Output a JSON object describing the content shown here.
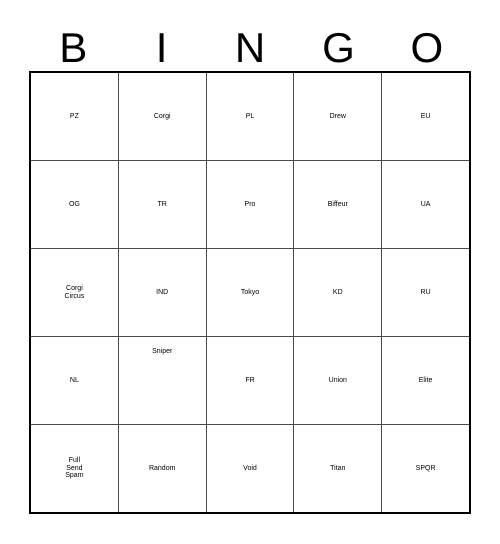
{
  "card": {
    "title_letters": [
      "B",
      "I",
      "N",
      "G",
      "O"
    ],
    "colors": {
      "background": "#ffffff",
      "text": "#000000",
      "grid_line": "#4a4a4a",
      "outer_border": "#000000"
    },
    "rows": [
      [
        {
          "text": "PZ",
          "size": "size-xl",
          "valign": "middle"
        },
        {
          "text": "Corgi",
          "size": "size-md",
          "valign": "middle"
        },
        {
          "text": "PL",
          "size": "size-xl",
          "valign": "middle"
        },
        {
          "text": "Drew",
          "size": "size-md",
          "valign": "middle"
        },
        {
          "text": "EU",
          "size": "size-xl",
          "valign": "middle"
        }
      ],
      [
        {
          "text": "OG",
          "size": "size-xl",
          "valign": "middle"
        },
        {
          "text": "TR",
          "size": "size-xl",
          "valign": "middle"
        },
        {
          "text": "Pro",
          "size": "size-xl",
          "valign": "middle"
        },
        {
          "text": "Biffeur",
          "size": "size-sm",
          "valign": "middle"
        },
        {
          "text": "UA",
          "size": "size-xl",
          "valign": "middle"
        }
      ],
      [
        {
          "text": "Corgi\nCircus",
          "size": "multi2",
          "valign": "middle"
        },
        {
          "text": "IND",
          "size": "size-xl",
          "valign": "middle"
        },
        {
          "text": "Tokyo",
          "size": "size-md",
          "valign": "middle"
        },
        {
          "text": "KD",
          "size": "size-xl",
          "valign": "middle"
        },
        {
          "text": "RU",
          "size": "size-xl",
          "valign": "middle"
        }
      ],
      [
        {
          "text": "NL",
          "size": "size-xl",
          "valign": "middle"
        },
        {
          "text": "Sniper",
          "size": "size-sm",
          "valign": "top"
        },
        {
          "text": "FR",
          "size": "size-xl",
          "valign": "middle"
        },
        {
          "text": "Union",
          "size": "size-md",
          "valign": "middle"
        },
        {
          "text": "Elite",
          "size": "size-lg",
          "valign": "middle"
        }
      ],
      [
        {
          "text": "Full\nSend\nSpam",
          "size": "multi3",
          "valign": "middle"
        },
        {
          "text": "Random",
          "size": "size-xs",
          "valign": "middle"
        },
        {
          "text": "Void",
          "size": "size-lg",
          "valign": "middle"
        },
        {
          "text": "Titan",
          "size": "size-lg",
          "valign": "middle"
        },
        {
          "text": "SPQR",
          "size": "size-md",
          "valign": "middle"
        }
      ]
    ]
  }
}
